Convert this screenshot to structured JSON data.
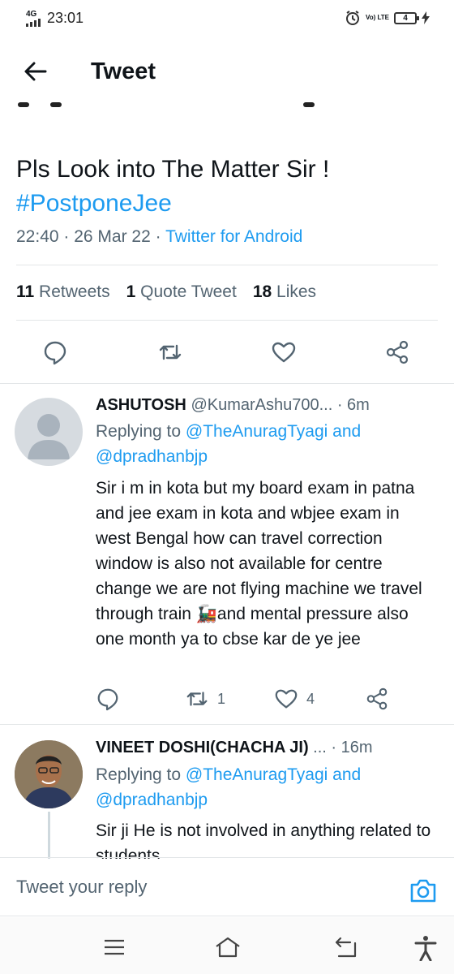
{
  "status_bar": {
    "network": "4G",
    "time": "23:01",
    "volte": "Vo) LTE",
    "battery": "4"
  },
  "header": {
    "back_icon": "arrow-left-icon",
    "title": "Tweet"
  },
  "tweet": {
    "text": "Pls Look into The Matter Sir !",
    "hashtag": "#PostponeJee",
    "timestamp": "22:40 · 26 Mar 22 · ",
    "source": "Twitter for Android",
    "stats": {
      "retweets_count": "11",
      "retweets_label": "Retweets",
      "quotes_count": "1",
      "quotes_label": "Quote Tweet",
      "likes_count": "18",
      "likes_label": "Likes"
    },
    "action_icons": [
      "reply-icon",
      "retweet-icon",
      "like-icon",
      "share-icon"
    ]
  },
  "replies": [
    {
      "name": "ASHUTOSH",
      "handle": "@KumarAshu700...",
      "time": "· 6m",
      "replying_prefix": "Replying to ",
      "mention_1": "@TheAnuragTyagi",
      "and": " and",
      "mention_2": "@dpradhanbjp",
      "text": "Sir i m in kota but my board exam in patna and jee exam in kota and wbjee exam in west Bengal how can travel correction window is also not available for centre change we are not flying machine we travel through train 🚂and mental pressure also one month ya to cbse kar de ye jee",
      "retweets": "1",
      "likes": "4"
    },
    {
      "name": "VINEET DOSHI(CHACHA JI)",
      "handle": "...",
      "time": "· 16m",
      "replying_prefix": "Replying to ",
      "mention_1": "@TheAnuragTyagi",
      "and": " and",
      "mention_2": "@dpradhanbjp",
      "text": "Sir ji He is not involved in anything related to students"
    }
  ],
  "composer": {
    "placeholder": "Tweet your reply",
    "camera_icon": "camera-icon"
  },
  "nav": {
    "icons": [
      "menu-icon",
      "home-icon",
      "back-icon",
      "accessibility-icon"
    ]
  },
  "colors": {
    "accent": "#1d9bf0",
    "secondary_text": "#536471",
    "primary_text": "#0f1419",
    "divider": "#e3e6e8"
  }
}
